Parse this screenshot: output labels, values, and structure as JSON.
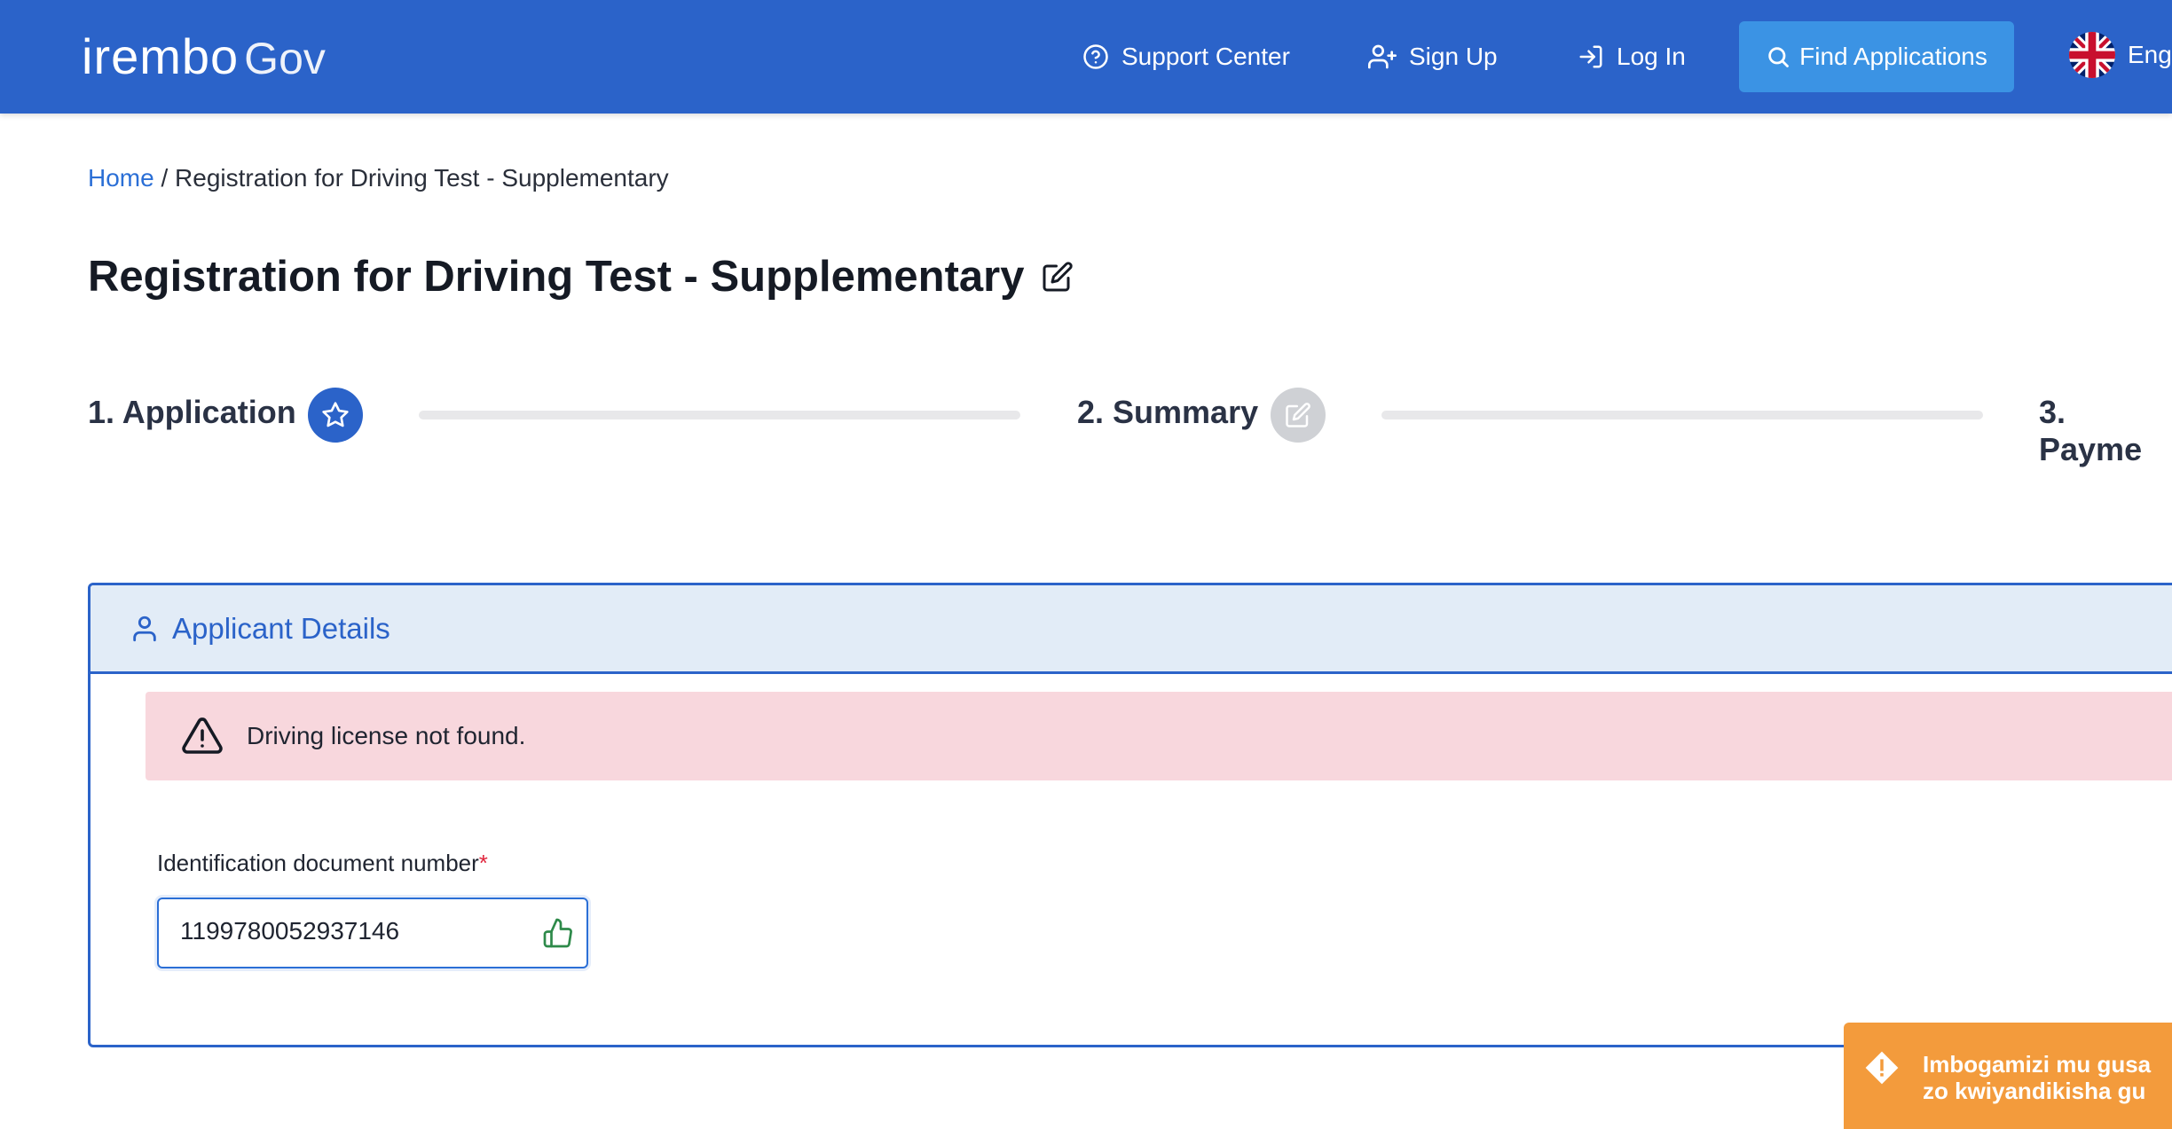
{
  "header": {
    "logo_main": "irembo",
    "logo_gov": "Gov",
    "support_label": "Support Center",
    "signup_label": "Sign Up",
    "login_label": "Log In",
    "find_label": "Find Applications",
    "language_label": "Eng"
  },
  "breadcrumb": {
    "home": "Home",
    "separator": " / ",
    "current": "Registration for Driving Test - Supplementary"
  },
  "page": {
    "title": "Registration for Driving Test - Supplementary"
  },
  "stepper": {
    "steps": [
      {
        "label": "1. Application",
        "state": "active"
      },
      {
        "label": "2. Summary",
        "state": "inactive"
      },
      {
        "label": "3. Payme",
        "state": "inactive"
      }
    ]
  },
  "panel": {
    "title": "Applicant Details",
    "alert_text": "Driving license not found.",
    "field_label": "Identification document number",
    "required_mark": "*",
    "field_value": "1199780052937146"
  },
  "toast": {
    "line1": "Imbogamizi mu gusa",
    "line2": "zo kwiyandikisha gu"
  },
  "colors": {
    "brand_blue": "#2b63c9",
    "find_button": "#3b93e4",
    "alert_bg": "#f8d7dd",
    "toast_bg": "#f39b3c",
    "required": "#e0263d"
  },
  "icons": [
    "help-circle-icon",
    "user-plus-icon",
    "log-in-icon",
    "search-icon",
    "uk-flag-icon",
    "edit-icon",
    "star-icon",
    "edit-square-icon",
    "user-icon",
    "warning-triangle-icon",
    "thumbs-up-icon",
    "alert-diamond-icon"
  ]
}
